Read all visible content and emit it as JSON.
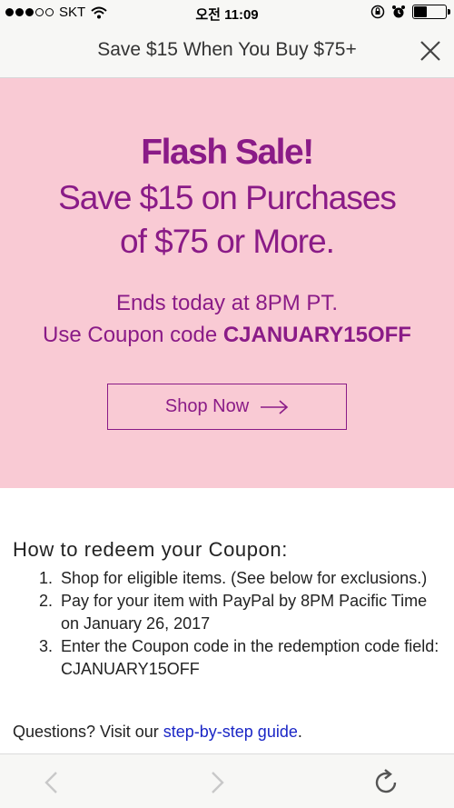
{
  "status_bar": {
    "carrier": "SKT",
    "time": "오전 11:09"
  },
  "banner": {
    "text": "Save $15 When You Buy $75+",
    "close_icon": "close-icon"
  },
  "hero": {
    "title": "Flash Sale!",
    "subtitle_line1": "Save $15 on Purchases",
    "subtitle_line2": "of $75 or More.",
    "ends_text": "Ends today at 8PM PT.",
    "coupon_prefix": "Use Coupon code ",
    "coupon_code": "CJANUARY15OFF",
    "shop_button_label": "Shop Now",
    "shop_button_icon": "arrow-right-icon"
  },
  "howto": {
    "title": "How to redeem your Coupon:",
    "steps": [
      {
        "num": "1.",
        "text": "Shop for eligible items. (See below for exclusions.)"
      },
      {
        "num": "2.",
        "text": "Pay for your item with PayPal by 8PM Pacific Time on January 26, 2017"
      },
      {
        "num": "3.",
        "text": "Enter the Coupon code in the redemption code field: CJANUARY15OFF"
      }
    ]
  },
  "questions": {
    "prefix": "Questions? Visit our ",
    "link_text": "step-by-step guide",
    "suffix": "."
  },
  "browser": {
    "back_icon": "chevron-left-icon",
    "forward_icon": "chevron-right-icon",
    "reload_icon": "reload-icon"
  },
  "colors": {
    "hero_bg": "#f9cad4",
    "hero_text": "#8a1b87",
    "link": "#1a26c6"
  }
}
